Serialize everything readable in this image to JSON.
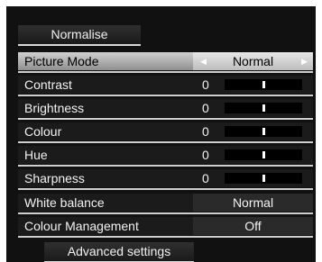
{
  "menu": {
    "normalise_label": "Normalise",
    "advanced_label": "Advanced settings",
    "rows": [
      {
        "label": "Picture Mode",
        "value": "Normal",
        "type": "select"
      },
      {
        "label": "Contrast",
        "value": "0",
        "type": "slider",
        "level": 0.5
      },
      {
        "label": "Brightness",
        "value": "0",
        "type": "slider",
        "level": 0.5
      },
      {
        "label": "Colour",
        "value": "0",
        "type": "slider",
        "level": 0.5
      },
      {
        "label": "Hue",
        "value": "0",
        "type": "slider",
        "level": 0.5
      },
      {
        "label": "Sharpness",
        "value": "0",
        "type": "slider",
        "level": 0.5
      },
      {
        "label": "White balance",
        "value": "Normal",
        "type": "value"
      },
      {
        "label": "Colour Management",
        "value": "Off",
        "type": "value"
      }
    ],
    "icons": {
      "left_arrow": "triangle-left-icon",
      "right_arrow": "triangle-right-icon"
    }
  }
}
